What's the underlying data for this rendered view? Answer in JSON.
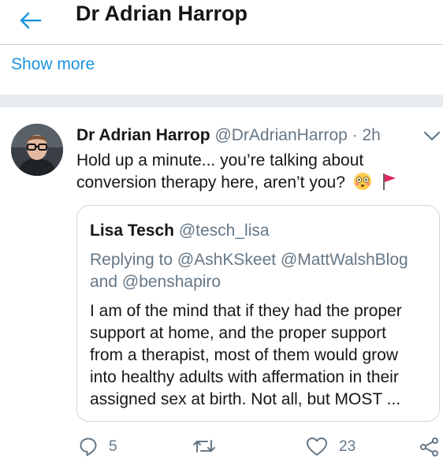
{
  "header": {
    "title": "Dr Adrian Harrop"
  },
  "show_more": "Show more",
  "tweet": {
    "author_name": "Dr Adrian Harrop",
    "author_handle": "@DrAdrianHarrop",
    "separator": "·",
    "time": "2h",
    "text_line1": "Hold up a minute... you’re talking about",
    "text_line2": "conversion therapy here, aren’t you?",
    "quote": {
      "author_name": "Lisa Tesch",
      "author_handle": "@tesch_lisa",
      "reply_line1": "Replying to @AshKSkeet @MattWalshBlog",
      "reply_line2": "and @benshapiro",
      "body_lines": [
        "I am of the mind that if they had the proper",
        "support at home, and the proper support",
        "from a therapist, most of them would grow",
        "into healthy adults with affermation in their",
        "assigned sex at birth.  Not all, but MOST ..."
      ]
    },
    "actions": {
      "reply_count": "5",
      "retweet_count": "",
      "like_count": "23"
    }
  },
  "colors": {
    "accent": "#1b95e0",
    "text": "#14171a",
    "muted": "#657786",
    "separator": "#e6ecf0",
    "flag": "#e0245e"
  },
  "icons": [
    "back-arrow-icon",
    "chevron-down-icon",
    "flushed-face-emoji-icon",
    "red-flag-emoji-icon",
    "reply-icon",
    "retweet-icon",
    "like-icon",
    "share-icon"
  ]
}
